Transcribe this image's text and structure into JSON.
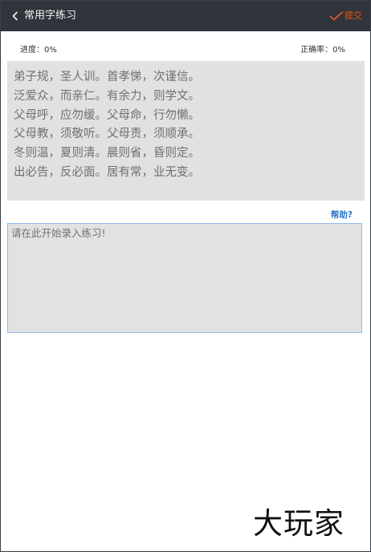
{
  "header": {
    "title": "常用字练习",
    "back_icon": "chevron-left-icon",
    "submit_icon": "check-icon",
    "submit_label": "提交",
    "background": "#30343b",
    "accent": "#e55a1b"
  },
  "stats": {
    "progress_text": "进度：0%",
    "accuracy_text": "正确率：0%"
  },
  "practice_text": {
    "lines": [
      "弟子规，圣人训。首孝悌，次谨信。",
      "泛爱众，而亲仁。有余力，则学文。",
      "父母呼，应勿缓。父母命，行勿懒。",
      "父母教，须敬听。父母责，须顺承。",
      "冬则温，夏则清。晨则省，昏则定。",
      "出必告，反必面。居有常，业无变。"
    ]
  },
  "help": {
    "label": "帮助?",
    "color": "#2c74c8"
  },
  "input": {
    "placeholder": "请在此开始录入练习!",
    "value": ""
  },
  "watermark": {
    "text": "大玩家"
  }
}
